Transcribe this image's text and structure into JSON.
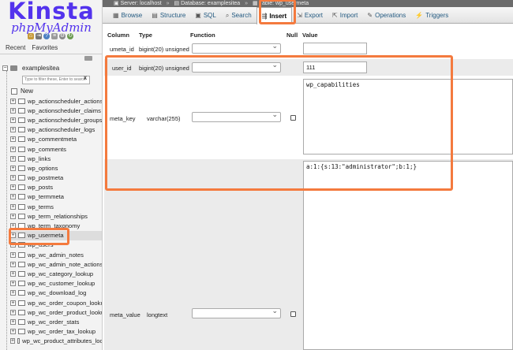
{
  "logo": {
    "brand": "Kinsta",
    "product": "phpMyAdmin"
  },
  "nav_tabs": [
    "Recent",
    "Favorites"
  ],
  "database": "examplesitea",
  "filter_placeholder": "Type to filter these, Enter to search",
  "filter_clear": "X",
  "new_label": "New",
  "tables": [
    "wp_actionscheduler_actions",
    "wp_actionscheduler_claims",
    "wp_actionscheduler_groups",
    "wp_actionscheduler_logs",
    "wp_commentmeta",
    "wp_comments",
    "wp_links",
    "wp_options",
    "wp_postmeta",
    "wp_posts",
    "wp_termmeta",
    "wp_terms",
    "wp_term_relationships",
    "wp_term_taxonomy",
    "wp_usermeta",
    "wp_users",
    "wp_wc_admin_notes",
    "wp_wc_admin_note_actions",
    "wp_wc_category_lookup",
    "wp_wc_customer_lookup",
    "wp_wc_download_log",
    "wp_wc_order_coupon_lookup",
    "wp_wc_order_product_lookup",
    "wp_wc_order_stats",
    "wp_wc_order_tax_lookup",
    "wp_wc_product_attributes_lookup"
  ],
  "selected_table": "wp_usermeta",
  "breadcrumb": {
    "server": "Server: localhost",
    "database": "Database: examplesitea",
    "table": "Table: wp_usermeta"
  },
  "tabs": [
    {
      "label": "Browse",
      "icon": "browse-icon"
    },
    {
      "label": "Structure",
      "icon": "structure-icon"
    },
    {
      "label": "SQL",
      "icon": "sql-icon"
    },
    {
      "label": "Search",
      "icon": "search-icon"
    },
    {
      "label": "Insert",
      "icon": "insert-icon"
    },
    {
      "label": "Export",
      "icon": "export-icon"
    },
    {
      "label": "Import",
      "icon": "import-icon"
    },
    {
      "label": "Operations",
      "icon": "operations-icon"
    },
    {
      "label": "Triggers",
      "icon": "triggers-icon"
    }
  ],
  "active_tab": "Insert",
  "columns_header": {
    "column": "Column",
    "type": "Type",
    "function": "Function",
    "null": "Null",
    "value": "Value"
  },
  "fields": [
    {
      "name": "umeta_id",
      "type": "bigint(20) unsigned",
      "value": ""
    },
    {
      "name": "user_id",
      "type": "bigint(20) unsigned",
      "value": "111"
    },
    {
      "name": "meta_key",
      "type": "varchar(255)",
      "value": "wp_capabilities"
    },
    {
      "name": "meta_value",
      "type": "longtext",
      "value": "a:1:{s:13:\"administrator\";b:1;}"
    }
  ],
  "colors": {
    "brand": "#5333ed",
    "highlight": "#f47a3e",
    "tab_text": "#235a81"
  }
}
